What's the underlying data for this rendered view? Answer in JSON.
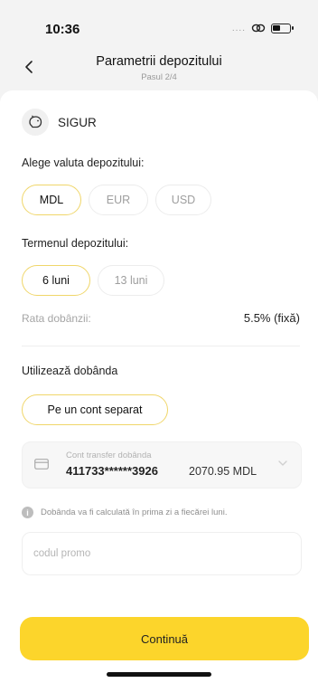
{
  "status_bar": {
    "time": "10:36",
    "signal_dots": "....",
    "icons": [
      "link-icon",
      "battery-icon"
    ]
  },
  "nav": {
    "title": "Parametrii depozitului",
    "step": "Pasul 2/4",
    "back_icon": "chevron-left-icon"
  },
  "product": {
    "name": "SIGUR",
    "icon": "piggy-bank-icon"
  },
  "currency": {
    "label": "Alege valuta depozitului:",
    "options": [
      "MDL",
      "EUR",
      "USD"
    ],
    "selected": "MDL"
  },
  "term": {
    "label": "Termenul depozitului:",
    "options": [
      "6 luni",
      "13 luni"
    ],
    "selected": "6 luni"
  },
  "rate": {
    "label": "Rata dobânzii:",
    "value": "5.5% (fixă)"
  },
  "interest": {
    "label": "Utilizează dobânda",
    "option": "Pe un cont separat",
    "selected": true
  },
  "transfer_account": {
    "label": "Cont transfer dobânda",
    "number": "411733******3926",
    "amount": "2070.95 MDL",
    "icon": "card-icon"
  },
  "info": {
    "text": "Dobânda va fi calculată în prima zi a fiecărei luni.",
    "icon": "info-icon"
  },
  "promo": {
    "placeholder": "codul promo",
    "value": ""
  },
  "continue_label": "Continuă",
  "colors": {
    "accent": "#fcd52b",
    "selected_border": "#f0d66a",
    "background": "#f3f3f3"
  }
}
